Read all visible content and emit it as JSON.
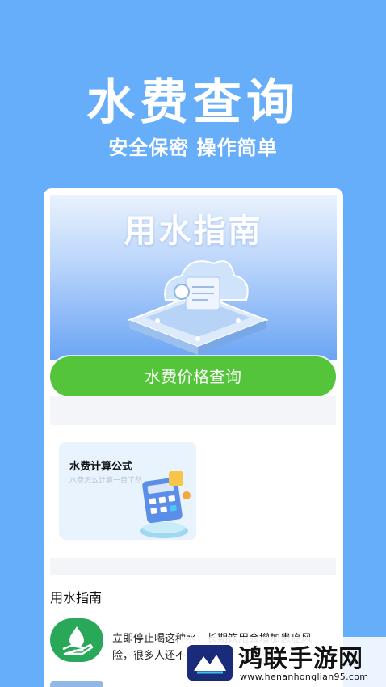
{
  "hero": {
    "title": "水费查询",
    "subtitle": "安全保密 操作简单"
  },
  "screen": {
    "banner_title": "用水指南",
    "query_button": "水费价格查询",
    "formula_card": {
      "title": "水费计算公式",
      "description": "水费怎么计算一目了然"
    },
    "guide_section": {
      "heading": "用水指南",
      "article_snippet": "立即停止喝这种水，长期饮用会增加患癌风险，很多人还不知道"
    }
  },
  "watermark": {
    "name": "鸿联手游网",
    "url": "www.henanhonglian95.com"
  },
  "colors": {
    "background": "#66aef9",
    "button_green": "#54c53a",
    "card_bg": "#e9f3fd"
  }
}
